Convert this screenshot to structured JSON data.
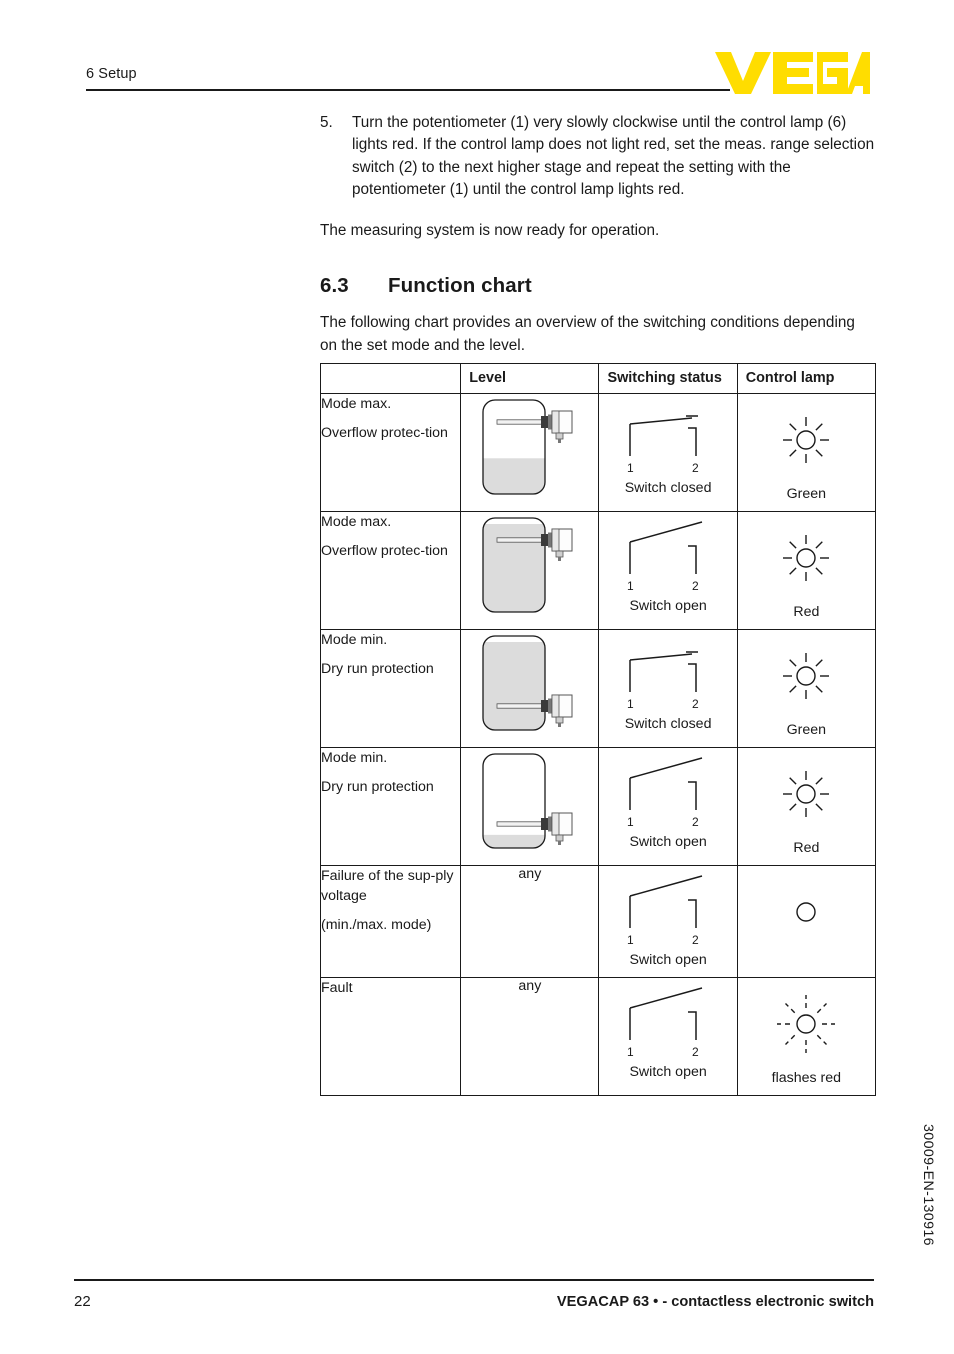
{
  "header": {
    "chapter": "6 Setup",
    "logo_text": "VEGA",
    "logo_color": "#FFDD00"
  },
  "body": {
    "step": {
      "number": "5.",
      "text": "Turn the potentiometer (1) very slowly clockwise until the control lamp (6) lights red. If the control lamp does not light red, set the meas. range selection switch (2) to the next higher stage and repeat the setting with the potentiometer (1) until the control lamp lights red."
    },
    "ready_note": "The measuring system is now ready for operation.",
    "section": {
      "number": "6.3",
      "title": "Function chart"
    },
    "intro": "The following chart provides an overview of the switching conditions depending on the set mode and the level."
  },
  "table": {
    "headers": [
      "",
      "Level",
      "Switching status",
      "Control lamp"
    ],
    "rows": [
      {
        "mode_lines": [
          "Mode max.",
          "Overflow protec-​tion"
        ],
        "level_type": "vessel",
        "level_text": "",
        "fill": "low",
        "probe": "top",
        "switch_state": "closed",
        "switch_caption": "Switch closed",
        "terminal_1": "1",
        "terminal_2": "2",
        "lamp": "on",
        "lamp_caption": "Green"
      },
      {
        "mode_lines": [
          "Mode max.",
          "Overflow protec-​tion"
        ],
        "level_type": "vessel",
        "level_text": "",
        "fill": "full",
        "probe": "top",
        "switch_state": "open",
        "switch_caption": "Switch open",
        "terminal_1": "1",
        "terminal_2": "2",
        "lamp": "on",
        "lamp_caption": "Red"
      },
      {
        "mode_lines": [
          "Mode min.",
          "Dry run protection"
        ],
        "level_type": "vessel",
        "level_text": "",
        "fill": "full",
        "probe": "bottom",
        "switch_state": "closed",
        "switch_caption": "Switch closed",
        "terminal_1": "1",
        "terminal_2": "2",
        "lamp": "on",
        "lamp_caption": "Green"
      },
      {
        "mode_lines": [
          "Mode min.",
          "Dry run protection"
        ],
        "level_type": "vessel",
        "level_text": "",
        "fill": "verylow",
        "probe": "bottom",
        "switch_state": "open",
        "switch_caption": "Switch open",
        "terminal_1": "1",
        "terminal_2": "2",
        "lamp": "on",
        "lamp_caption": "Red"
      },
      {
        "mode_lines": [
          "Failure of the sup-​ply voltage",
          "(min./max. mode)"
        ],
        "level_type": "text",
        "level_text": "any",
        "fill": "",
        "probe": "",
        "switch_state": "open",
        "switch_caption": "Switch open",
        "terminal_1": "1",
        "terminal_2": "2",
        "lamp": "off",
        "lamp_caption": ""
      },
      {
        "mode_lines": [
          "Fault"
        ],
        "level_type": "text",
        "level_text": "any",
        "fill": "",
        "probe": "",
        "switch_state": "open",
        "switch_caption": "Switch open",
        "terminal_1": "1",
        "terminal_2": "2",
        "lamp": "flashing",
        "lamp_caption": "flashes red"
      }
    ]
  },
  "footer": {
    "page_number": "22",
    "document_title": "VEGACAP 63 • - contactless electronic switch",
    "doc_code": "30009-EN-130916"
  }
}
